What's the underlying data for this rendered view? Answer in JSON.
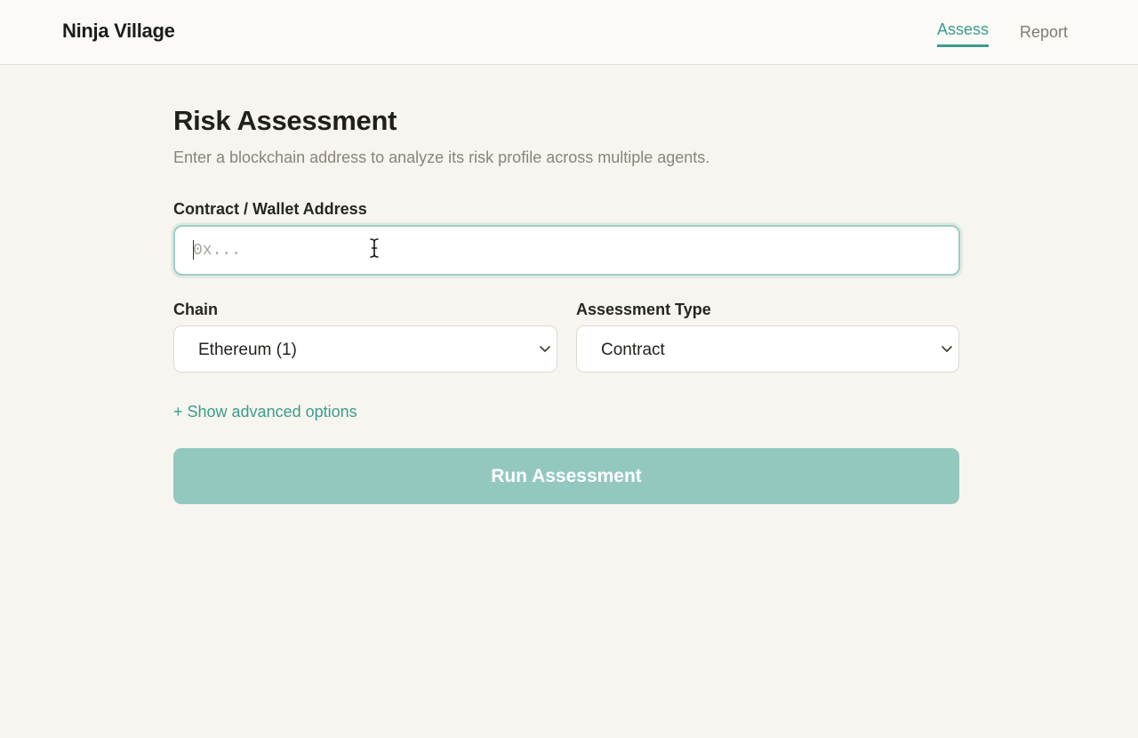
{
  "header": {
    "brand": "Ninja Village",
    "nav": {
      "assess": "Assess",
      "report": "Report"
    },
    "active_tab": "Assess"
  },
  "main": {
    "title": "Risk Assessment",
    "subtitle": "Enter a blockchain address to analyze its risk profile across multiple agents."
  },
  "form": {
    "address_label": "Contract / Wallet Address",
    "address_placeholder": "0x...",
    "address_value": "",
    "chain_label": "Chain",
    "chain_value": "Ethereum (1)",
    "type_label": "Assessment Type",
    "type_value": "Contract",
    "advanced_link": "+ Show advanced options",
    "submit_label": "Run Assessment"
  },
  "colors": {
    "accent": "#3a9d8c",
    "button_disabled": "#93c8bf",
    "background": "#f7f5f0"
  }
}
